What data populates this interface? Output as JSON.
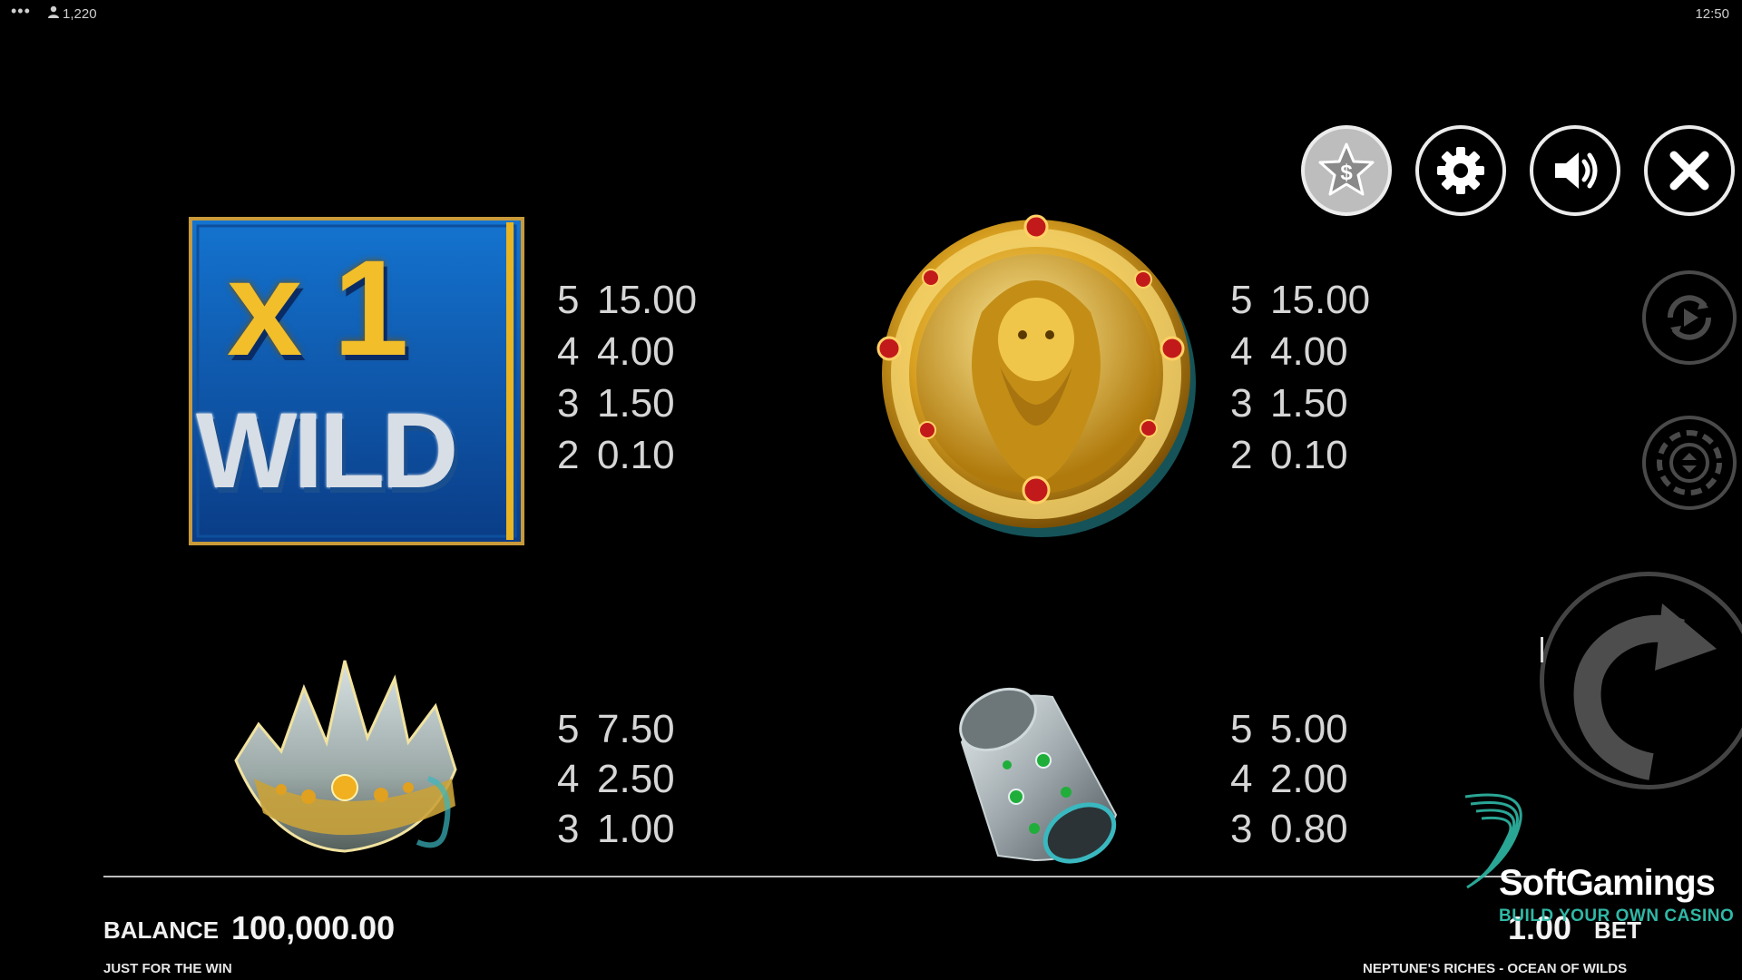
{
  "status_bar": {
    "dots": "•••",
    "player_count": "1,220",
    "time": "12:50"
  },
  "controls": {
    "buy_icon": "star-dollar-icon",
    "settings_icon": "gear-icon",
    "sound_icon": "speaker-icon",
    "close_icon": "close-icon",
    "autoplay_icon": "autoplay-icon",
    "bet_icon": "chip-icon",
    "spin_icon": "spin-arrow-icon"
  },
  "paytable": {
    "wild": {
      "symbol_text_multiplier": "x 1",
      "symbol_text_word": "WILD",
      "rows": [
        {
          "count": "5",
          "payout": "15.00"
        },
        {
          "count": "4",
          "payout": "4.00"
        },
        {
          "count": "3",
          "payout": "1.50"
        },
        {
          "count": "2",
          "payout": "0.10"
        }
      ]
    },
    "neptune_coin": {
      "rows": [
        {
          "count": "5",
          "payout": "15.00"
        },
        {
          "count": "4",
          "payout": "4.00"
        },
        {
          "count": "3",
          "payout": "1.50"
        },
        {
          "count": "2",
          "payout": "0.10"
        }
      ]
    },
    "crown": {
      "rows": [
        {
          "count": "5",
          "payout": "7.50"
        },
        {
          "count": "4",
          "payout": "2.50"
        },
        {
          "count": "3",
          "payout": "1.00"
        }
      ]
    },
    "silver_ring": {
      "rows": [
        {
          "count": "5",
          "payout": "5.00"
        },
        {
          "count": "4",
          "payout": "2.00"
        },
        {
          "count": "3",
          "payout": "0.80"
        }
      ]
    }
  },
  "footer": {
    "balance_label": "BALANCE",
    "balance_value": "100,000.00",
    "bet_value": "1.00",
    "bet_label": "BET",
    "left_caption": "JUST FOR THE WIN",
    "right_caption": "NEPTUNE'S RICHES - OCEAN OF WILDS"
  },
  "watermark": {
    "name": "SoftGamings",
    "tagline": "BUILD YOUR OWN CASINO"
  },
  "colors": {
    "background": "#000000",
    "text": "#d6d6d6",
    "gold": "#e8b422",
    "wild_blue": "#1a74c9",
    "watermark_teal": "#2fb8a6"
  }
}
